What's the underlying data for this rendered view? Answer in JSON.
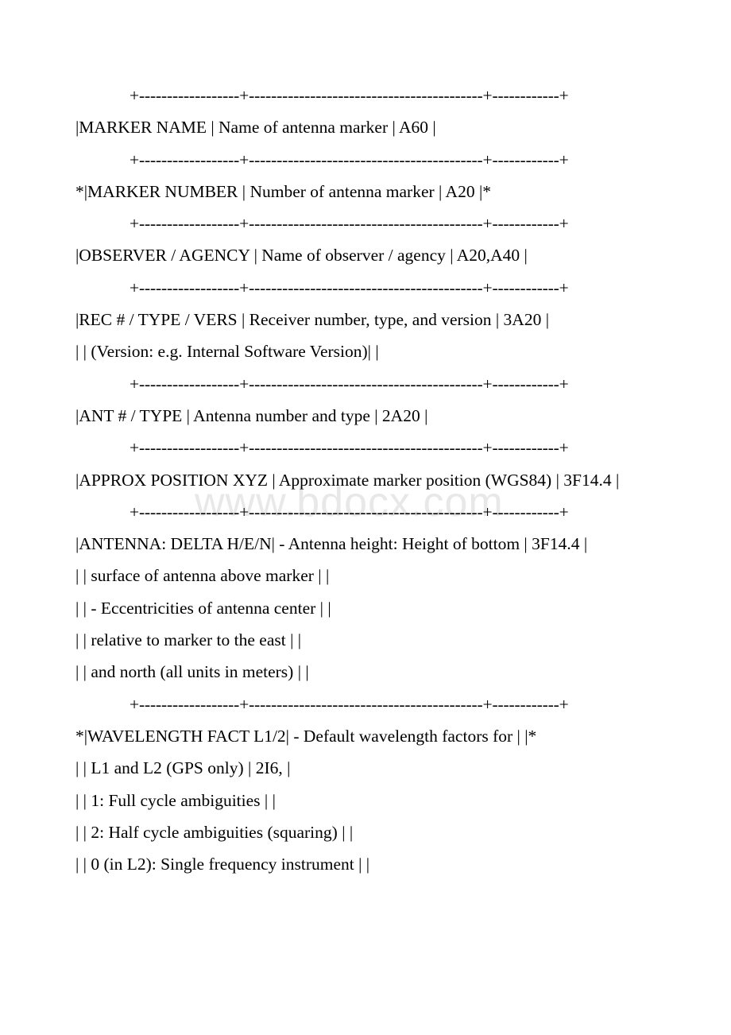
{
  "document": {
    "type": "plain-text-ascii-table",
    "watermark": "www.bdocx.com",
    "separator": "+------------------+------------------------------------------+------------+",
    "lines": [
      {
        "id": "sep-1",
        "kind": "separator",
        "text": "+------------------+------------------------------------------+------------+"
      },
      {
        "id": "marker-name",
        "kind": "row",
        "text": "|MARKER NAME | Name of antenna marker | A60 |"
      },
      {
        "id": "sep-2",
        "kind": "separator",
        "text": "+------------------+------------------------------------------+------------+"
      },
      {
        "id": "marker-number",
        "kind": "row-star",
        "text": "*|MARKER NUMBER | Number of antenna marker | A20 |*"
      },
      {
        "id": "sep-3",
        "kind": "separator",
        "text": "+------------------+------------------------------------------+------------+"
      },
      {
        "id": "observer-agency",
        "kind": "row",
        "text": "|OBSERVER / AGENCY | Name of observer / agency | A20,A40 |"
      },
      {
        "id": "sep-4",
        "kind": "separator",
        "text": "+------------------+------------------------------------------+------------+"
      },
      {
        "id": "rec-type-vers",
        "kind": "row",
        "text": "|REC # / TYPE / VERS | Receiver number, type, and version | 3A20 |"
      },
      {
        "id": "rec-type-vers-cont",
        "kind": "row",
        "text": "| | (Version: e.g. Internal Software Version)| |"
      },
      {
        "id": "sep-5",
        "kind": "separator",
        "text": "+------------------+------------------------------------------+------------+"
      },
      {
        "id": "ant-type",
        "kind": "row",
        "text": "|ANT # / TYPE | Antenna number and type | 2A20 |"
      },
      {
        "id": "sep-6",
        "kind": "separator",
        "text": "+------------------+------------------------------------------+------------+"
      },
      {
        "id": "approx-position",
        "kind": "row",
        "text": "|APPROX POSITION XYZ | Approximate marker position (WGS84) | 3F14.4 |"
      },
      {
        "id": "sep-7",
        "kind": "separator",
        "text": "+------------------+------------------------------------------+------------+"
      },
      {
        "id": "antenna-delta",
        "kind": "row",
        "text": "|ANTENNA: DELTA H/E/N| - Antenna height: Height of bottom | 3F14.4 |"
      },
      {
        "id": "antenna-delta-c1",
        "kind": "row",
        "text": "| | surface of antenna above marker | |"
      },
      {
        "id": "antenna-delta-c2",
        "kind": "row",
        "text": "| | - Eccentricities of antenna center | |"
      },
      {
        "id": "antenna-delta-c3",
        "kind": "row",
        "text": "| | relative to marker to the east | |"
      },
      {
        "id": "antenna-delta-c4",
        "kind": "row",
        "text": "| | and north (all units in meters) | |"
      },
      {
        "id": "sep-8",
        "kind": "separator",
        "text": "+------------------+------------------------------------------+------------+"
      },
      {
        "id": "wavelength-fact",
        "kind": "row-star",
        "text": "*|WAVELENGTH FACT L1/2| - Default wavelength factors for | |*"
      },
      {
        "id": "wavelength-c1",
        "kind": "row",
        "text": "| | L1 and L2 (GPS only) | 2I6, |"
      },
      {
        "id": "wavelength-c2",
        "kind": "row",
        "text": "| | 1: Full cycle ambiguities | |"
      },
      {
        "id": "wavelength-c3",
        "kind": "row",
        "text": "| | 2: Half cycle ambiguities (squaring) | |"
      },
      {
        "id": "wavelength-c4",
        "kind": "row",
        "text": "| | 0 (in L2): Single frequency instrument | |"
      }
    ]
  },
  "colors": {
    "text": "#000000",
    "background": "#ffffff",
    "watermark": "#e8e8e8"
  }
}
